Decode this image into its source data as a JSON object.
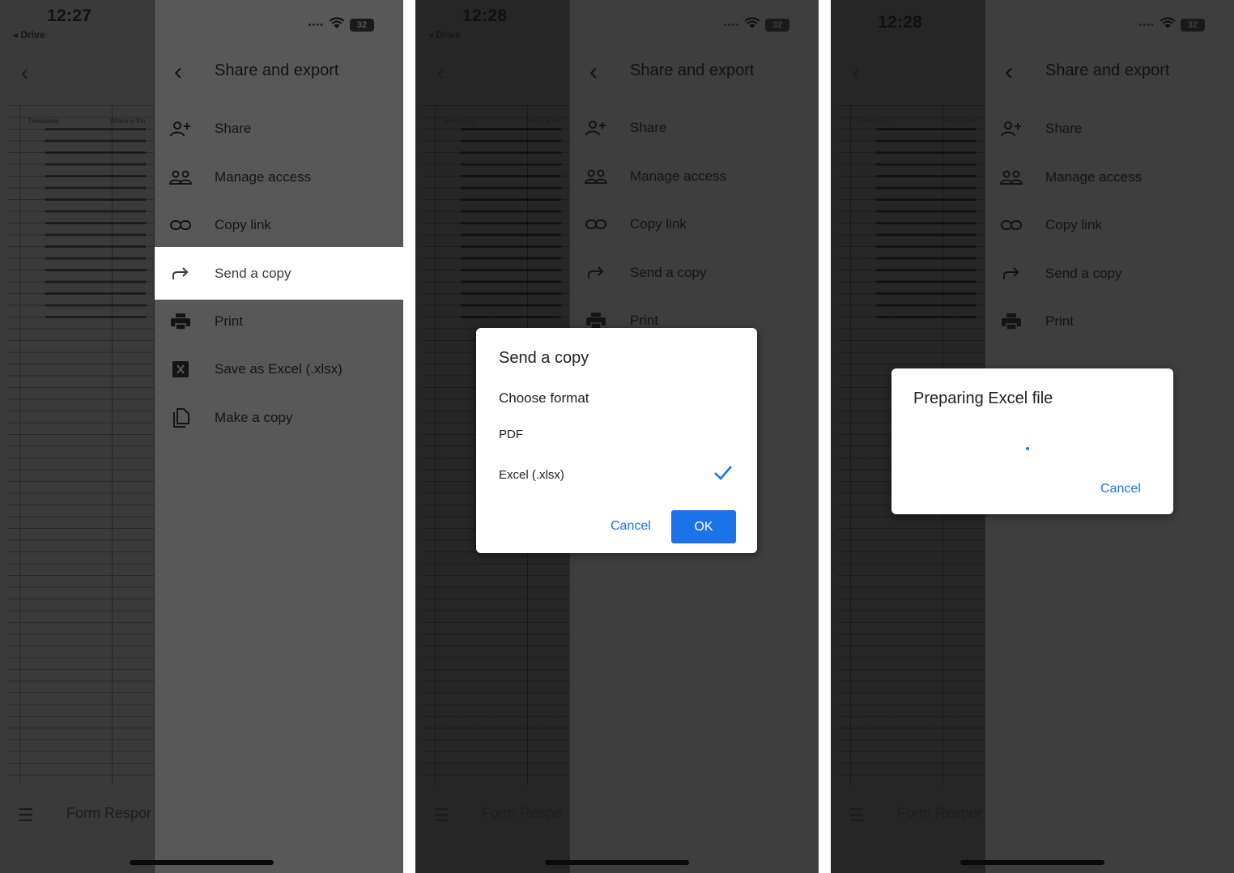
{
  "screens": [
    {
      "time": "12:27",
      "back_app": "◂ Drive",
      "battery": "32",
      "drawer_title": "Share and export",
      "sheet_footer": "Form Respor",
      "sheet_header": [
        "Timestamp",
        "Which is the"
      ]
    },
    {
      "time": "12:28",
      "back_app": "◂ Drive",
      "battery": "32",
      "drawer_title": "Share and export",
      "sheet_footer": "Form Respo",
      "sheet_header": [
        "Timestamp",
        "Which is the"
      ]
    },
    {
      "time": "12:28",
      "battery": "32",
      "drawer_title": "Share and export",
      "sheet_footer": "Form Respor",
      "sheet_header": [
        "Timestamp",
        "Which is the"
      ]
    }
  ],
  "menu": {
    "share": "Share",
    "manage_access": "Manage access",
    "copy_link": "Copy link",
    "send_copy": "Send a copy",
    "print": "Print",
    "save_excel": "Save as Excel (.xlsx)",
    "make_copy": "Make a copy"
  },
  "send_dialog": {
    "title": "Send a copy",
    "subtitle": "Choose format",
    "options": [
      "PDF",
      "Excel (.xlsx)"
    ],
    "selected": "Excel (.xlsx)",
    "cancel": "Cancel",
    "ok": "OK"
  },
  "preparing_dialog": {
    "title": "Preparing Excel file",
    "cancel": "Cancel"
  },
  "accent_color": "#1a73e8"
}
